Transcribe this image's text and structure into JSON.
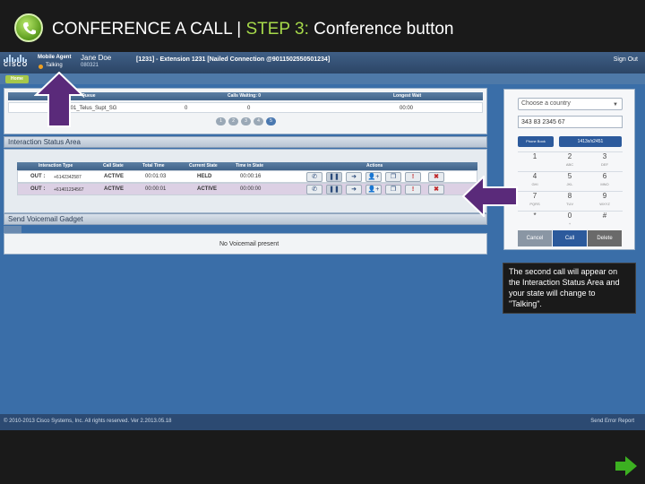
{
  "slide": {
    "title_main": "CONFERENCE A CALL | ",
    "title_step": "STEP 3:",
    "title_rest": " Conference button",
    "callout": "The second call will appear on the Interaction Status Area and your state will change to \"Talking\"."
  },
  "header": {
    "agent_label": "Mobile Agent",
    "agent_name": "Jane Doe",
    "agent_id": "080321",
    "state": "Talking",
    "extension_info": "[1231] - Extension 1231 [Nailed Connection @9011502550501234]",
    "sign_out": "Sign Out"
  },
  "nav": {
    "home": "Home"
  },
  "queue": {
    "headers": [
      "Queue",
      "Calls Waiting: 0",
      "Longest Wait"
    ],
    "row": [
      "1001_Telus_Supt_SG",
      "0",
      "0",
      "00:00"
    ],
    "pager": [
      "1",
      "2",
      "3",
      "4",
      "5"
    ],
    "active_page": 4
  },
  "interaction": {
    "section_title": "Interaction Status Area",
    "headers": [
      "Interaction Type",
      "Call State",
      "Total Time",
      "Current State",
      "Time in State",
      "Actions"
    ],
    "rows": [
      {
        "type": "OUT :",
        "number": "+6142342587",
        "state": "ACTIVE",
        "total": "00:01:03",
        "current": "HELD",
        "in_state": "00:00:16"
      },
      {
        "type": "OUT :",
        "number": "+61401234567",
        "state": "ACTIVE",
        "total": "00:00:01",
        "current": "ACTIVE",
        "in_state": "00:00:00"
      }
    ],
    "action_icons": [
      "phone-icon",
      "hold-icon",
      "transfer-icon",
      "conference-icon",
      "consult-icon",
      "alert-icon",
      "end-call-icon"
    ],
    "action_glyphs": [
      "✆",
      "❚❚",
      "➜",
      "👤+",
      "❐",
      "!",
      "✖"
    ]
  },
  "voicemail": {
    "section_title": "Send Voicemail Gadget",
    "empty_text": "No Voicemail present"
  },
  "dialpad": {
    "country_placeholder": "Choose a country",
    "number": "343 83 2345 67",
    "phonebook": "Phone Book",
    "keyboard": "1413x/x2451",
    "keys": [
      {
        "n": "1",
        "l": ""
      },
      {
        "n": "2",
        "l": "ABC"
      },
      {
        "n": "3",
        "l": "DEF"
      },
      {
        "n": "4",
        "l": "GHI"
      },
      {
        "n": "5",
        "l": "JKL"
      },
      {
        "n": "6",
        "l": "MNO"
      },
      {
        "n": "7",
        "l": "PQRS"
      },
      {
        "n": "8",
        "l": "TUV"
      },
      {
        "n": "9",
        "l": "WXYZ"
      },
      {
        "n": "*",
        "l": ""
      },
      {
        "n": "0",
        "l": "+"
      },
      {
        "n": "#",
        "l": ""
      }
    ],
    "cancel": "Cancel",
    "call": "Call",
    "delete": "Delete"
  },
  "footer": {
    "copyright": "© 2010-2013 Cisco Systems, Inc. All rights reserved. Ver 2.2013.05.18",
    "error_report": "Send Error Report"
  },
  "colors": {
    "slide_bg": "#1a1a1a",
    "app_bg": "#3a6ea8",
    "step_accent": "#a6d94a",
    "annotation_arrow": "#5a2a7a",
    "next_arrow": "#3cb021"
  }
}
